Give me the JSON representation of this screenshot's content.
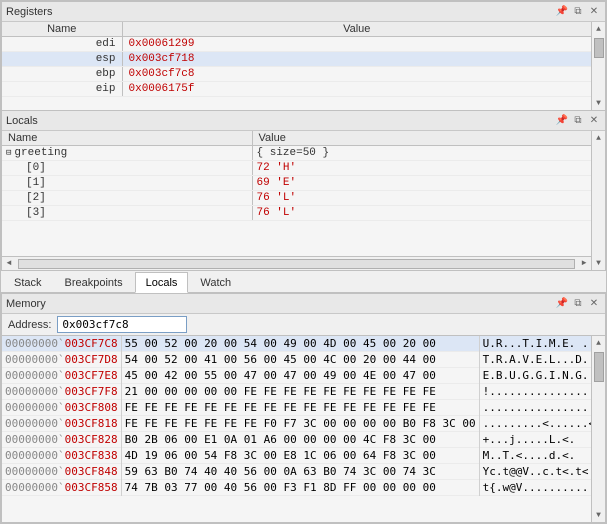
{
  "registers": {
    "title": "Registers",
    "columns": [
      "Name",
      "Value"
    ],
    "rows": [
      {
        "name": "edi",
        "value": "0x00061299",
        "highlight": false
      },
      {
        "name": "esp",
        "value": "0x003cf718",
        "highlight": true
      },
      {
        "name": "ebp",
        "value": "0x003cf7c8",
        "highlight": false
      },
      {
        "name": "eip",
        "value": "0x0006175f",
        "highlight": false
      }
    ]
  },
  "locals": {
    "title": "Locals",
    "columns": [
      "Name",
      "Value"
    ],
    "rows": [
      {
        "indent": 0,
        "expand": true,
        "name": "greeting",
        "value": "{ size=50 }"
      },
      {
        "indent": 1,
        "expand": false,
        "name": "[0]",
        "value": "72 'H'"
      },
      {
        "indent": 1,
        "expand": false,
        "name": "[1]",
        "value": "69 'E'"
      },
      {
        "indent": 1,
        "expand": false,
        "name": "[2]",
        "value": "76 'L'"
      },
      {
        "indent": 1,
        "expand": false,
        "name": "[3]",
        "value": "76 'L'"
      }
    ]
  },
  "tabs": {
    "items": [
      "Stack",
      "Breakpoints",
      "Locals",
      "Watch"
    ],
    "active": "Locals"
  },
  "memory": {
    "title": "Memory",
    "address_label": "Address:",
    "address_value": "0x003cf7c8",
    "rows": [
      {
        "seg": "00000000`",
        "off": "003CF7C8",
        "hex": "55 00 52 00 20 00 54 00 49 00 4D 00 45 00 20 00",
        "ascii": "U.R...T.I.M.E. ."
      },
      {
        "seg": "00000000`",
        "off": "003CF7D8",
        "hex": "54 00 52 00 41 00 56 00 45 00 4C 00 20 00 44 00",
        "ascii": "T.R.A.V.E.L...D."
      },
      {
        "seg": "00000000`",
        "off": "003CF7E8",
        "hex": "45 00 42 00 55 00 47 00 47 00 49 00 4E 00 47 00",
        "ascii": "E.B.U.G.G.I.N.G."
      },
      {
        "seg": "00000000`",
        "off": "003CF7F8",
        "hex": "21 00 00 00 00 00 FE FE FE FE FE FE FE FE FE FE",
        "ascii": "!..............."
      },
      {
        "seg": "00000000`",
        "off": "003CF808",
        "hex": "FE FE FE FE FE FE FE FE FE FE FE FE FE FE FE FE",
        "ascii": "................"
      },
      {
        "seg": "00000000`",
        "off": "003CF818",
        "hex": "FE FE FE FE FE FE FE F0 F7 3C 00 00 00 00 B0 F8 3C 00",
        "ascii": ".........<......<."
      },
      {
        "seg": "00000000`",
        "off": "003CF828",
        "hex": "B0 2B 06 00 E1 0A 01 A6 00 00 00 00 4C F8 3C 00",
        "ascii": "+...j.....L.<."
      },
      {
        "seg": "00000000`",
        "off": "003CF838",
        "hex": "4D 19 06 00 54 F8 3C 00 E8 1C 06 00 64 F8 3C 00",
        "ascii": "M..T.<....d.<."
      },
      {
        "seg": "00000000`",
        "off": "003CF848",
        "hex": "59 63 B0 74 40 40 56 00 0A 63 B0 74 3C 00 74 3C",
        "ascii": "Yc.t@@V..c.t<.t<"
      },
      {
        "seg": "00000000`",
        "off": "003CF858",
        "hex": "74 7B 03 77 00 40 56 00 F3 F1 8D FF 00 00 00 00",
        "ascii": "t{.w@V.........."
      }
    ]
  }
}
